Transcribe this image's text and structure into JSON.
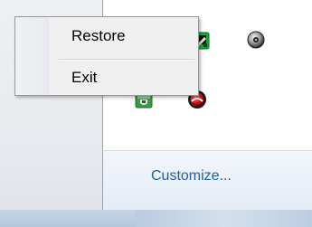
{
  "context_menu": {
    "items": [
      {
        "label": "Restore"
      },
      {
        "label": "Exit"
      }
    ]
  },
  "tray_overflow": {
    "customize_label": "Customize...",
    "icons": [
      {
        "name": "green-app-icon"
      },
      {
        "name": "disc-icon"
      },
      {
        "name": "shield-icon"
      },
      {
        "name": "record-icon"
      }
    ]
  },
  "colors": {
    "link": "#1f5fa8",
    "menu_background": "#f0f0f0",
    "menu_border": "#979797",
    "panel_border": "#9aa3ad",
    "taskbar": "#b4c7dc"
  }
}
